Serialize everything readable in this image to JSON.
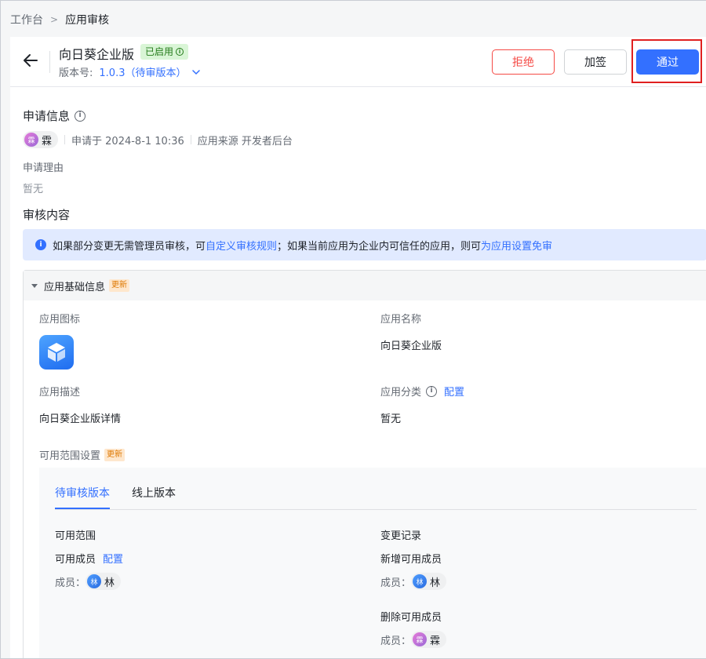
{
  "breadcrumb": {
    "root": "工作台",
    "current": "应用审核"
  },
  "header": {
    "app_name": "向日葵企业版",
    "status_badge": "已启用",
    "version_label": "版本号:",
    "version_value": "1.0.3（待审版本）",
    "reject_label": "拒绝",
    "sign_label": "加签",
    "pass_label": "通过"
  },
  "application": {
    "title": "申请信息",
    "applicant_avatar_char": "霖",
    "applicant_name": "霖",
    "applied_at": "申请于 2024-8-1 10:36",
    "source": "应用来源 开发者后台",
    "reason_label": "申请理由",
    "reason_value": "暂无"
  },
  "review": {
    "title": "审核内容",
    "notice_prefix": "如果部分变更无需管理员审核，可",
    "notice_link1": "自定义审核规则",
    "notice_mid": "；如果当前应用为企业内可信任的应用，则可",
    "notice_link2": "为应用设置免审"
  },
  "basic_info": {
    "title": "应用基础信息",
    "new_tag": "更新",
    "icon_label": "应用图标",
    "name_label": "应用名称",
    "name_value": "向日葵企业版",
    "desc_label": "应用描述",
    "desc_value": "向日葵企业版详情",
    "category_label": "应用分类",
    "category_link": "配置",
    "category_value": "暂无",
    "scope_label": "可用范围设置",
    "scope_tag": "更新"
  },
  "scope": {
    "tabs": [
      "待审核版本",
      "线上版本"
    ],
    "range_title": "可用范围",
    "members_label": "可用成员",
    "members_link": "配置",
    "member_prefix": "成员：",
    "member_name": "林",
    "member_avatar_char": "林",
    "changes_title": "变更记录",
    "added_title": "新增可用成员",
    "added_name": "林",
    "added_avatar_char": "林",
    "removed_title": "删除可用成员",
    "removed_name": "霖",
    "removed_avatar_char": "霖"
  },
  "colors": {
    "primary": "#3370ff",
    "danger": "#f54a45",
    "success_bg": "#d9f5d6",
    "highlight_box": "#e02020"
  }
}
